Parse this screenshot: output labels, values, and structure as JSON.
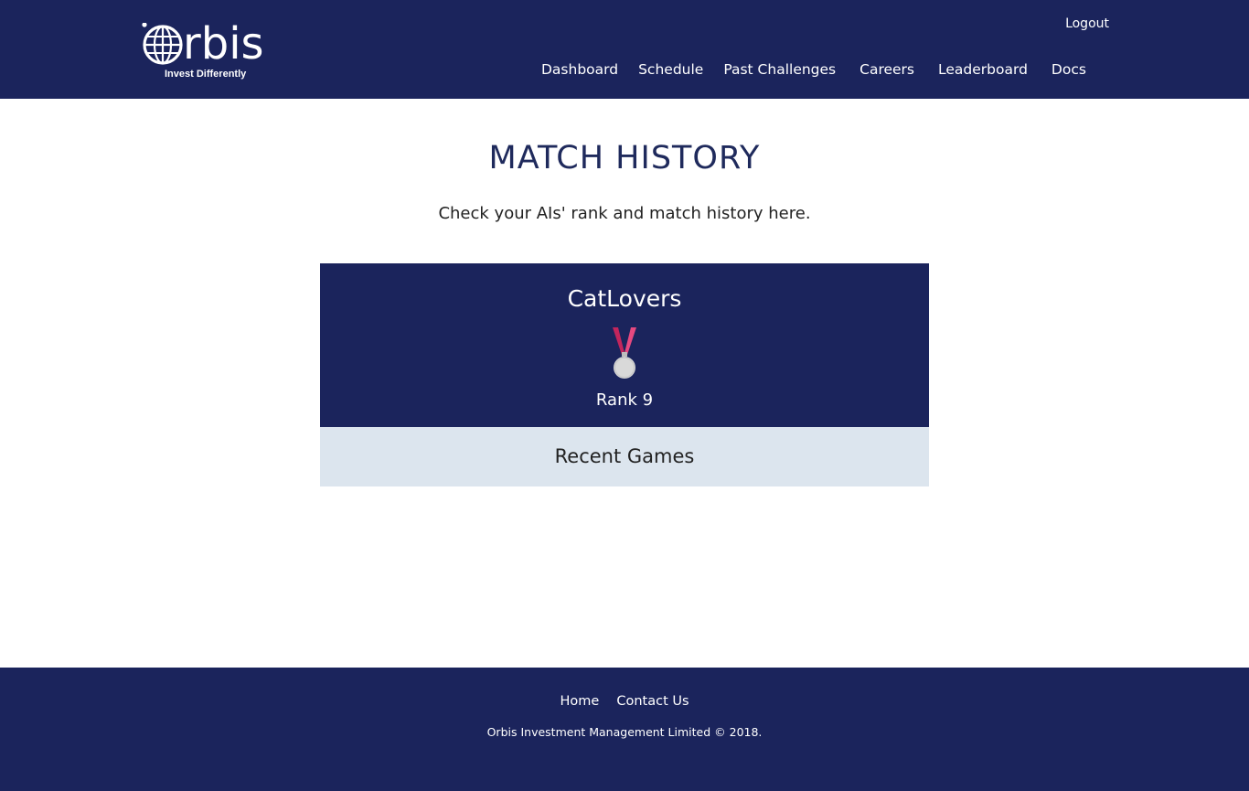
{
  "header": {
    "logo_word": "rbis",
    "logo_tagline": "Invest Differently",
    "logout_label": "Logout",
    "nav": [
      {
        "label": "Dashboard"
      },
      {
        "label": "Schedule"
      },
      {
        "label": "Past Challenges"
      },
      {
        "label": "Careers"
      },
      {
        "label": "Leaderboard"
      },
      {
        "label": "Docs"
      }
    ]
  },
  "main": {
    "title": "MATCH HISTORY",
    "subtitle": "Check your AIs' rank and match history here."
  },
  "card": {
    "team_name": "CatLovers",
    "medal_icon": "medal-icon",
    "rank_label": "Rank 9",
    "recent_games_label": "Recent Games"
  },
  "footer": {
    "links": [
      {
        "label": "Home"
      },
      {
        "label": "Contact Us"
      }
    ],
    "copyright": "Orbis Investment Management Limited © 2018."
  },
  "colors": {
    "navy": "#1b245c",
    "light_panel": "#dce5ee",
    "medal_ribbon": "#d6336c",
    "medal_silver": "#d9d9d9"
  }
}
